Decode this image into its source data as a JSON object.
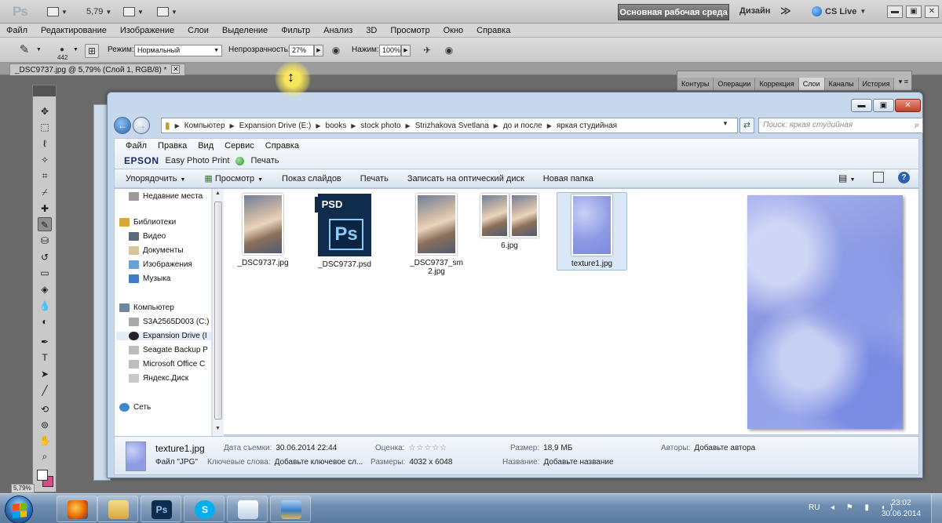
{
  "photoshop": {
    "logo": "Ps",
    "zoom_value": "5,79",
    "workspace_button": "Основная рабочая среда",
    "design_label": "Дизайн",
    "more": "≫",
    "cs_live": "CS Live",
    "menu": [
      "Файл",
      "Редактирование",
      "Изображение",
      "Слои",
      "Выделение",
      "Фильтр",
      "Анализ",
      "3D",
      "Просмотр",
      "Окно",
      "Справка"
    ],
    "options": {
      "brush_size": "442",
      "mode_label": "Режим:",
      "mode_value": "Нормальный",
      "opacity_label": "Непрозрачность:",
      "opacity_value": "27%",
      "pressure_label": "Нажим:",
      "pressure_value": "100%"
    },
    "doc_tab": "_DSC9737.jpg @ 5,79% (Слой 1, RGB/8) *",
    "doc_tab_close": "✕",
    "panel_tabs": [
      "Контуры",
      "Операции",
      "Коррекция",
      "Слои",
      "Каналы",
      "История"
    ],
    "panel_menu": "▾ ≡",
    "status_zoom": "5,79%"
  },
  "explorer": {
    "controls": {
      "minimize": "▬",
      "maximize": "▣",
      "close": "✕"
    },
    "breadcrumb": [
      "Компьютер",
      "Expansion Drive (E:)",
      "books",
      "stock photo",
      "Strizhakova Svetlana",
      "до и после",
      "яркая студийная"
    ],
    "search_placeholder": "Поиск: яркая студийная",
    "menu": [
      "Файл",
      "Правка",
      "Вид",
      "Сервис",
      "Справка"
    ],
    "epson": "EPSON",
    "epson_app": "Easy Photo Print",
    "epson_print": "Печать",
    "commands": {
      "organize": "Упорядочить",
      "view": "Просмотр",
      "slideshow": "Показ слайдов",
      "print": "Печать",
      "burn": "Записать на оптический диск",
      "new_folder": "Новая папка"
    },
    "nav": {
      "recent": "Недавние места",
      "libraries": "Библиотеки",
      "video": "Видео",
      "documents": "Документы",
      "images": "Изображения",
      "music": "Музыка",
      "computer": "Компьютер",
      "drive_c": "S3A2565D003 (C:)",
      "drive_e": "Expansion Drive (I",
      "seagate": "Seagate Backup P",
      "msoffice": "Microsoft Office C",
      "yadisk": "Яндекс.Диск",
      "network": "Сеть"
    },
    "files": [
      {
        "name": "_DSC9737.jpg"
      },
      {
        "name": "_DSC9737.psd",
        "badge": "PSD",
        "logo": "Ps"
      },
      {
        "name": "_DSC9737_sm2.jpg"
      },
      {
        "name": "6.jpg"
      },
      {
        "name": "texture1.jpg"
      }
    ],
    "details": {
      "name": "texture1.jpg",
      "type": "Файл \"JPG\"",
      "date_label": "Дата съемки:",
      "date_value": "30.06.2014 22:44",
      "keywords_label": "Ключевые слова:",
      "keywords_value": "Добавьте ключевое сл...",
      "rating_label": "Оценка:",
      "rating_stars": "☆☆☆☆☆",
      "dims_label": "Размеры:",
      "dims_value": "4032 x 6048",
      "size_label": "Размер:",
      "size_value": "18,9 МБ",
      "title_label": "Название:",
      "title_value": "Добавьте название",
      "authors_label": "Авторы:",
      "authors_value": "Добавьте автора"
    }
  },
  "taskbar": {
    "lang": "RU",
    "tray_icons": "◂ ⚑ ▮ ◖)",
    "time": "23:02",
    "date": "30.06.2014",
    "apps": [
      "firefox",
      "explorer",
      "photoshop",
      "skype",
      "notes",
      "photo-viewer"
    ],
    "app_glyphs": {
      "photoshop": "Ps",
      "skype": "S"
    }
  },
  "colors": {
    "accent": "#2a6fb4",
    "selection": "#dbe8f7",
    "foreground_swatch": "#ffffff",
    "background_swatch": "#d24f86"
  }
}
